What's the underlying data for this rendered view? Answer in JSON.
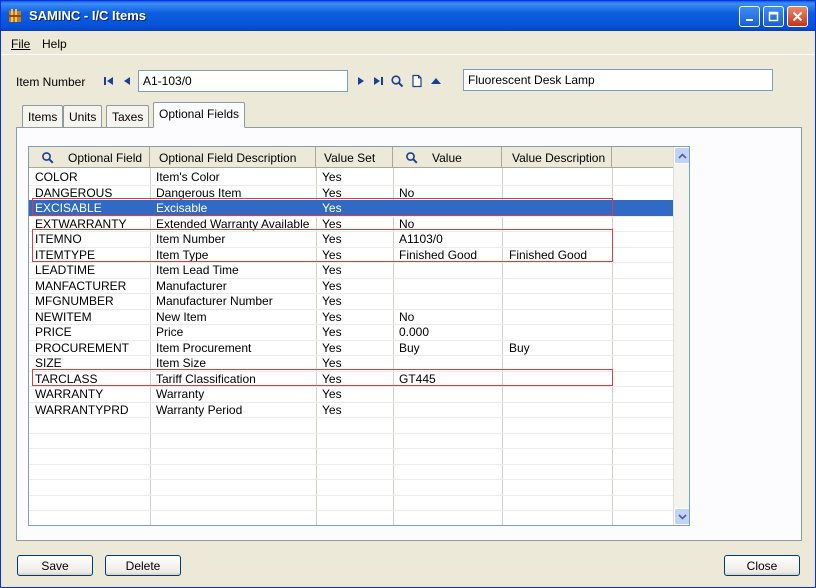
{
  "window": {
    "title": "SAMINC - I/C Items"
  },
  "menu": [
    {
      "label": "File"
    },
    {
      "label": "Help"
    }
  ],
  "item": {
    "label": "Item Number",
    "number": "A1-103/0",
    "description": "Fluorescent Desk Lamp"
  },
  "tabs": [
    {
      "label": "Items"
    },
    {
      "label": "Units"
    },
    {
      "label": "Taxes"
    },
    {
      "label": "Optional Fields",
      "active": true
    }
  ],
  "grid": {
    "columns": [
      "Optional Field",
      "Optional Field Description",
      "Value Set",
      "Value",
      "Value Description"
    ],
    "rows": [
      [
        "COLOR",
        "Item's Color",
        "Yes",
        "",
        ""
      ],
      [
        "DANGEROUS",
        "Dangerous Item",
        "Yes",
        "No",
        ""
      ],
      [
        "EXCISABLE",
        "Excisable",
        "Yes",
        "",
        ""
      ],
      [
        "EXTWARRANTY",
        "Extended Warranty Available",
        "Yes",
        "No",
        ""
      ],
      [
        "ITEMNO",
        "Item Number",
        "Yes",
        "A1103/0",
        ""
      ],
      [
        "ITEMTYPE",
        "Item Type",
        "Yes",
        "Finished Good",
        "Finished Good"
      ],
      [
        "LEADTIME",
        "Item Lead Time",
        "Yes",
        "",
        ""
      ],
      [
        "MANFACTURER",
        "Manufacturer",
        "Yes",
        "",
        ""
      ],
      [
        "MFGNUMBER",
        "Manufacturer Number",
        "Yes",
        "",
        ""
      ],
      [
        "NEWITEM",
        "New Item",
        "Yes",
        "No",
        ""
      ],
      [
        "PRICE",
        "Price",
        "Yes",
        "0.000",
        ""
      ],
      [
        "PROCUREMENT",
        "Item Procurement",
        "Yes",
        "Buy",
        "Buy"
      ],
      [
        "SIZE",
        "Item Size",
        "Yes",
        "",
        ""
      ],
      [
        "TARCLASS",
        "Tariff Classification",
        "Yes",
        "GT445",
        ""
      ],
      [
        "WARRANTY",
        "Warranty",
        "Yes",
        "",
        ""
      ],
      [
        "WARRANTYPRD",
        "Warranty Period",
        "Yes",
        "",
        ""
      ]
    ],
    "selected_row": 2,
    "highlighted_rows": [
      2,
      4,
      5,
      13
    ]
  },
  "buttons": {
    "save": "Save",
    "delete": "Delete",
    "close": "Close"
  },
  "colors": {
    "selection": "#316ac5",
    "highlight": "#e8383d",
    "titlebar": "#0551d6"
  },
  "icons": [
    "app-icon",
    "first-record-icon",
    "previous-record-icon",
    "next-record-icon",
    "last-record-icon",
    "finder-icon",
    "new-document-icon",
    "zoom-up-icon",
    "minimize-icon",
    "maximize-icon",
    "close-icon",
    "search-icon"
  ]
}
